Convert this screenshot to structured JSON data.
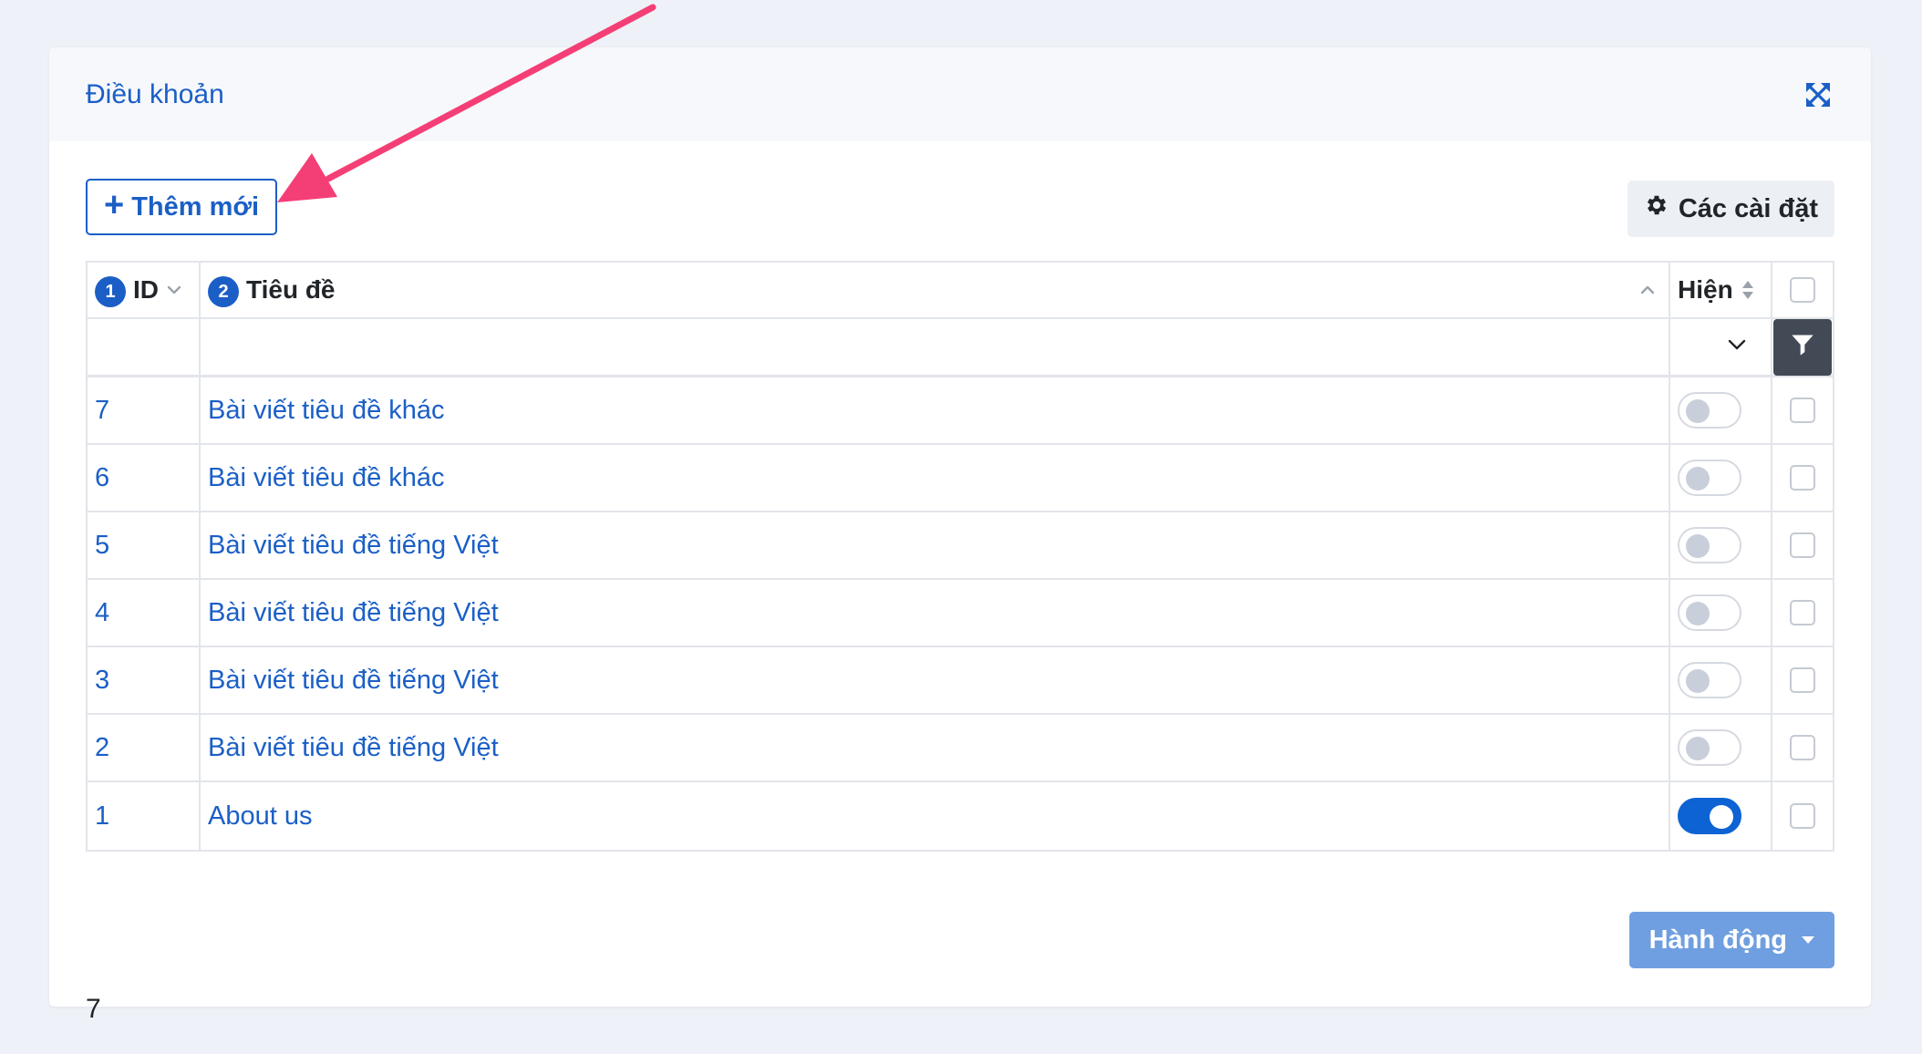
{
  "card": {
    "title": "Điều khoản"
  },
  "toolbar": {
    "add_label": "Thêm mới",
    "settings_label": "Các cài đặt"
  },
  "table": {
    "headers": {
      "id": {
        "badge": "1",
        "label": "ID"
      },
      "title": {
        "badge": "2",
        "label": "Tiêu đề"
      },
      "show": {
        "label": "Hiện"
      }
    },
    "rows": [
      {
        "id": "7",
        "title": "Bài viết tiêu đề khác",
        "show": false
      },
      {
        "id": "6",
        "title": "Bài viết tiêu đề khác",
        "show": false
      },
      {
        "id": "5",
        "title": "Bài viết tiêu đề tiếng Việt",
        "show": false
      },
      {
        "id": "4",
        "title": "Bài viết tiêu đề tiếng Việt",
        "show": false
      },
      {
        "id": "3",
        "title": "Bài viết tiêu đề tiếng Việt",
        "show": false
      },
      {
        "id": "2",
        "title": "Bài viết tiêu đề tiếng Việt",
        "show": false
      },
      {
        "id": "1",
        "title": "About us",
        "show": true
      }
    ]
  },
  "actions": {
    "label": "Hành động"
  },
  "footer": {
    "total": "7"
  },
  "colors": {
    "primary": "#1b5fc6",
    "toggle_on": "#0d62d4",
    "action_button": "#6f9fe0",
    "annotation_arrow": "#f43f76"
  }
}
